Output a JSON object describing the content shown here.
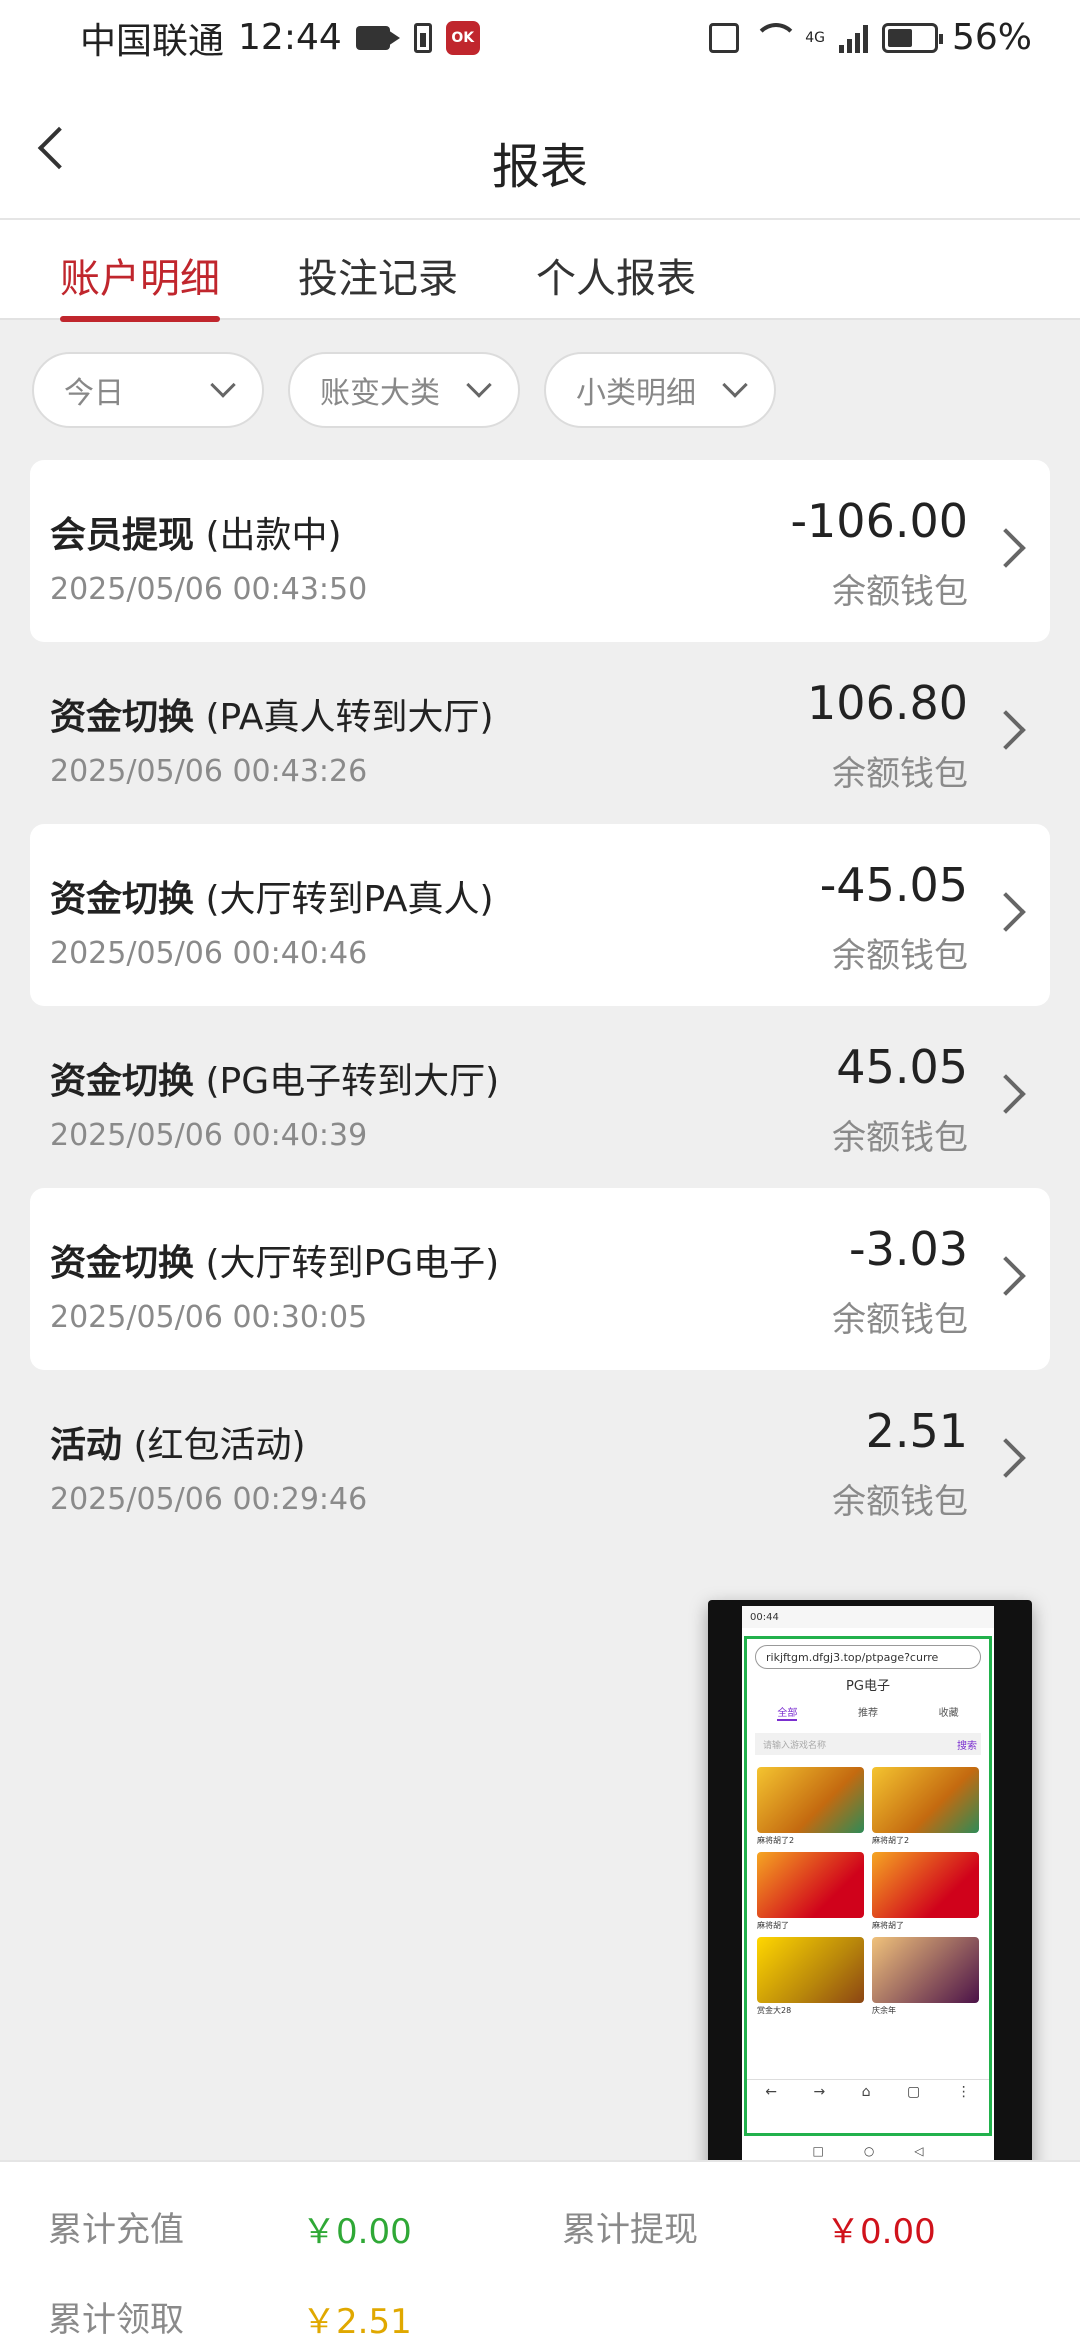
{
  "status_bar": {
    "carrier": "中国联通",
    "time": "12:44",
    "app_badge": "OK",
    "network": "4G",
    "battery": "56%"
  },
  "header": {
    "title": "报表"
  },
  "tabs": [
    {
      "label": "账户明细",
      "active": true
    },
    {
      "label": "投注记录",
      "active": false
    },
    {
      "label": "个人报表",
      "active": false
    }
  ],
  "filters": [
    {
      "label": "今日"
    },
    {
      "label": "账变大类"
    },
    {
      "label": "小类明细"
    }
  ],
  "transactions": [
    {
      "type": "会员提现",
      "detail": "(出款中)",
      "datetime": "2025/05/06 00:43:50",
      "amount": "-106.00",
      "wallet": "余额钱包"
    },
    {
      "type": "资金切换",
      "detail": "(PA真人转到大厅)",
      "datetime": "2025/05/06 00:43:26",
      "amount": "106.80",
      "wallet": "余额钱包"
    },
    {
      "type": "资金切换",
      "detail": "(大厅转到PA真人)",
      "datetime": "2025/05/06 00:40:46",
      "amount": "-45.05",
      "wallet": "余额钱包"
    },
    {
      "type": "资金切换",
      "detail": "(PG电子转到大厅)",
      "datetime": "2025/05/06 00:40:39",
      "amount": "45.05",
      "wallet": "余额钱包"
    },
    {
      "type": "资金切换",
      "detail": "(大厅转到PG电子)",
      "datetime": "2025/05/06 00:30:05",
      "amount": "-3.03",
      "wallet": "余额钱包"
    },
    {
      "type": "活动",
      "detail": "(红包活动)",
      "datetime": "2025/05/06 00:29:46",
      "amount": "2.51",
      "wallet": "余额钱包"
    }
  ],
  "pip": {
    "time": "00:44",
    "url": "rikjftgm.dfgj3.top/ptpage?curre",
    "title": "PG电子",
    "tabs": [
      "全部",
      "推荐",
      "收藏"
    ],
    "search_placeholder": "请输入游戏名称",
    "search_button": "搜索",
    "games": [
      "麻将胡了2",
      "麻将胡了2",
      "麻将胡了",
      "麻将胡了",
      "赏金大28",
      "庆余年"
    ]
  },
  "footer": {
    "total_recharge_label": "累计充值",
    "total_recharge_value": "￥0.00",
    "total_withdraw_label": "累计提现",
    "total_withdraw_value": "￥0.00",
    "total_claimed_label": "累计领取",
    "total_claimed_value": "￥2.51"
  }
}
